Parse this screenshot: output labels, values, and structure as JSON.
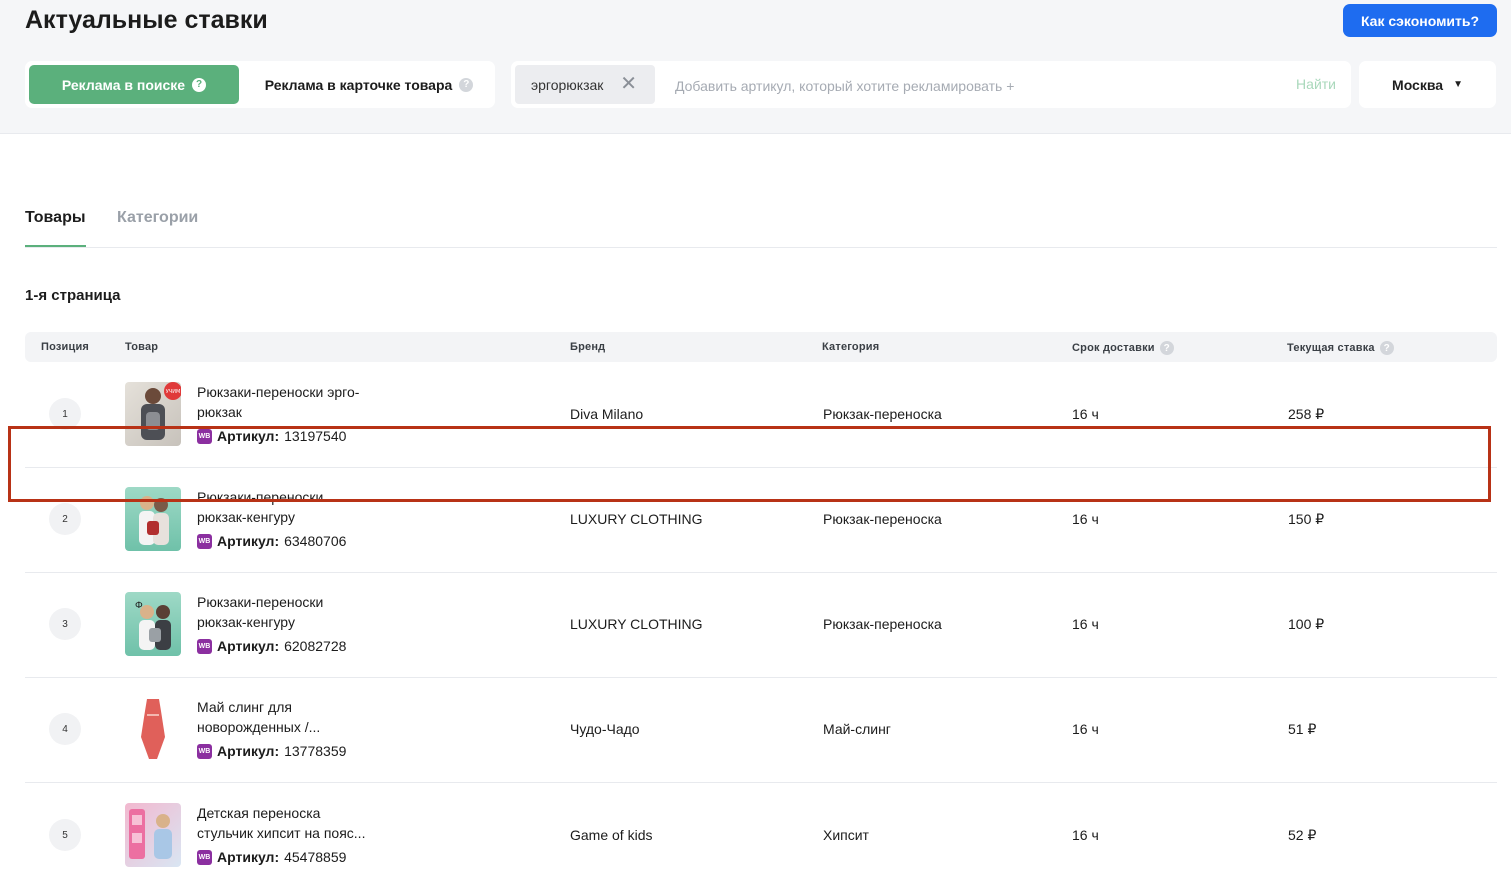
{
  "header": {
    "title": "Актуальные ставки",
    "help_button": "Как сэкономить?"
  },
  "mode_toggle": {
    "active_label": "Реклама в поиске",
    "inactive_label": "Реклама в карточке товара"
  },
  "search": {
    "chip": "эргорюкзак",
    "placeholder": "Добавить артикул, который хотите рекламировать +",
    "find_label": "Найти"
  },
  "city": {
    "selected": "Москва"
  },
  "tabs": [
    "Товары",
    "Категории"
  ],
  "section_title": "1-я страница",
  "table": {
    "headers": {
      "position": "Позиция",
      "product": "Товар",
      "brand": "Бренд",
      "category": "Категория",
      "delivery": "Срок доставки",
      "bid": "Текущая ставка"
    },
    "sku_label": "Артикул:",
    "rows": [
      {
        "position": "1",
        "name_line1": "Рюкзаки-переноски эрго-",
        "name_line2": "рюкзак",
        "sku": "13197540",
        "brand": "Diva Milano",
        "category": "Рюкзак-переноска",
        "delivery": "16 ч",
        "bid": "258 ₽",
        "thumb_badge": "УЧИМ"
      },
      {
        "position": "2",
        "name_line1": "Рюкзаки-переноски",
        "name_line2": "рюкзак-кенгуру",
        "sku": "63480706",
        "brand": "LUXURY CLOTHING",
        "category": "Рюкзак-переноска",
        "delivery": "16 ч",
        "bid": "150 ₽"
      },
      {
        "position": "3",
        "name_line1": "Рюкзаки-переноски",
        "name_line2": "рюкзак-кенгуру",
        "sku": "62082728",
        "brand": "LUXURY CLOTHING",
        "category": "Рюкзак-переноска",
        "delivery": "16 ч",
        "bid": "100 ₽",
        "thumb_badge": "Ф"
      },
      {
        "position": "4",
        "name_line1": "Май слинг для",
        "name_line2": "новорожденных /...",
        "sku": "13778359",
        "brand": "Чудо-Чадо",
        "category": "Май-слинг",
        "delivery": "16 ч",
        "bid": "51 ₽"
      },
      {
        "position": "5",
        "name_line1": "Детская переноска",
        "name_line2": "стульчик хипсит на пояс...",
        "sku": "45478859",
        "brand": "Game of kids",
        "category": "Хипсит",
        "delivery": "16 ч",
        "bid": "52 ₽"
      }
    ]
  },
  "icons": {
    "question": "?",
    "close": "✕",
    "caret": "▼",
    "wb": "WB"
  },
  "colors": {
    "accent_green": "#5bb07c",
    "primary_blue": "#1e6cf0",
    "wb_purple": "#8b2fa0",
    "highlight_red": "#b83216"
  }
}
